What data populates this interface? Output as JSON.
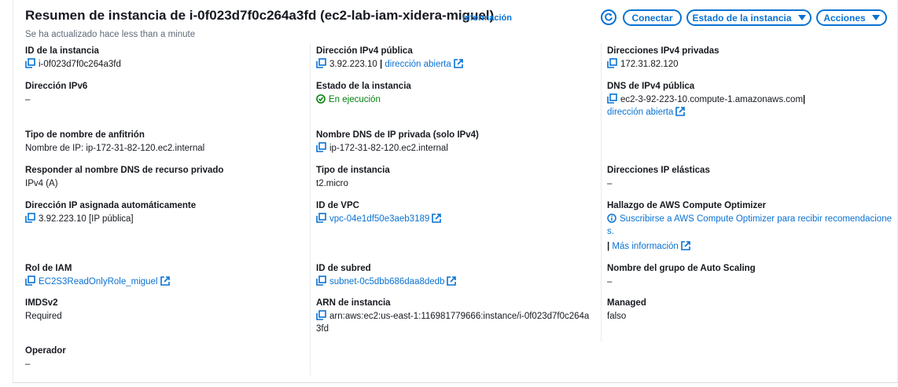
{
  "header": {
    "title": "Resumen de instancia de i-0f023d7f0c264a3fd (ec2-lab-iam-xidera-miguel)",
    "info": "Información",
    "updated": "Se ha actualizado hace less than a minute",
    "buttons": {
      "connect": "Conectar",
      "state": "Estado de la instancia",
      "actions": "Acciones"
    }
  },
  "col1": {
    "instance_id": {
      "label": "ID de la instancia",
      "value": "i-0f023d7f0c264a3fd"
    },
    "ipv6": {
      "label": "Dirección IPv6",
      "value": "–"
    },
    "hostname_type": {
      "label": "Tipo de nombre de anfitrión",
      "value": "Nombre de IP: ip-172-31-82-120.ec2.internal"
    },
    "resource_dns": {
      "label": "Responder al nombre DNS de recurso privado",
      "value": "IPv4 (A)"
    },
    "auto_ip": {
      "label": "Dirección IP asignada automáticamente",
      "value": "3.92.223.10 [IP pública]"
    },
    "iam_role": {
      "label": "Rol de IAM",
      "value": "EC2S3ReadOnlyRole_miguel"
    },
    "imdsv2": {
      "label": "IMDSv2",
      "value": "Required"
    },
    "operator": {
      "label": "Operador",
      "value": "–"
    }
  },
  "col2": {
    "public_ipv4": {
      "label": "Dirección IPv4 pública",
      "value": "3.92.223.10",
      "sep": "|",
      "link": "dirección abierta"
    },
    "state": {
      "label": "Estado de la instancia",
      "value": "En ejecución"
    },
    "private_dns": {
      "label": "Nombre DNS de IP privada (solo IPv4)",
      "value": "ip-172-31-82-120.ec2.internal"
    },
    "instance_type": {
      "label": "Tipo de instancia",
      "value": "t2.micro"
    },
    "vpc": {
      "label": "ID de VPC",
      "value": "vpc-04e1df50e3aeb3189"
    },
    "subnet": {
      "label": "ID de subred",
      "value": "subnet-0c5dbb686daa8dedb"
    },
    "arn": {
      "label": "ARN de instancia",
      "value_line1": "arn:aws:ec2:us-east-1:116981779666:instance/i-0f023d7f0c264a",
      "value_line2": "3fd"
    }
  },
  "col3": {
    "private_ipv4": {
      "label": "Direcciones IPv4 privadas",
      "value": "172.31.82.120"
    },
    "public_dns": {
      "label": "DNS de IPv4 pública",
      "value": "ec2-3-92-223-10.compute-1.amazonaws.com",
      "sep": "|",
      "link": "dirección abierta"
    },
    "elastic_ip": {
      "label": "Direcciones IP elásticas",
      "value": "–"
    },
    "optimizer": {
      "label": "Hallazgo de AWS Compute Optimizer",
      "line1": "Suscribirse a AWS Compute Optimizer para recibir recomendacione",
      "line2": "s.",
      "sep": "|",
      "more": "Más información"
    },
    "asg": {
      "label": "Nombre del grupo de Auto Scaling",
      "value": "–"
    },
    "managed": {
      "label": "Managed",
      "value": "falso"
    }
  },
  "colors": {
    "accent": "#0972d3",
    "success": "#037f0c",
    "text": "#16191f",
    "muted": "#5f6b7a"
  },
  "icons": [
    "copy-icon",
    "external-link-icon",
    "refresh-icon",
    "caret-down-icon",
    "check-circle-icon",
    "info-circle-icon"
  ]
}
